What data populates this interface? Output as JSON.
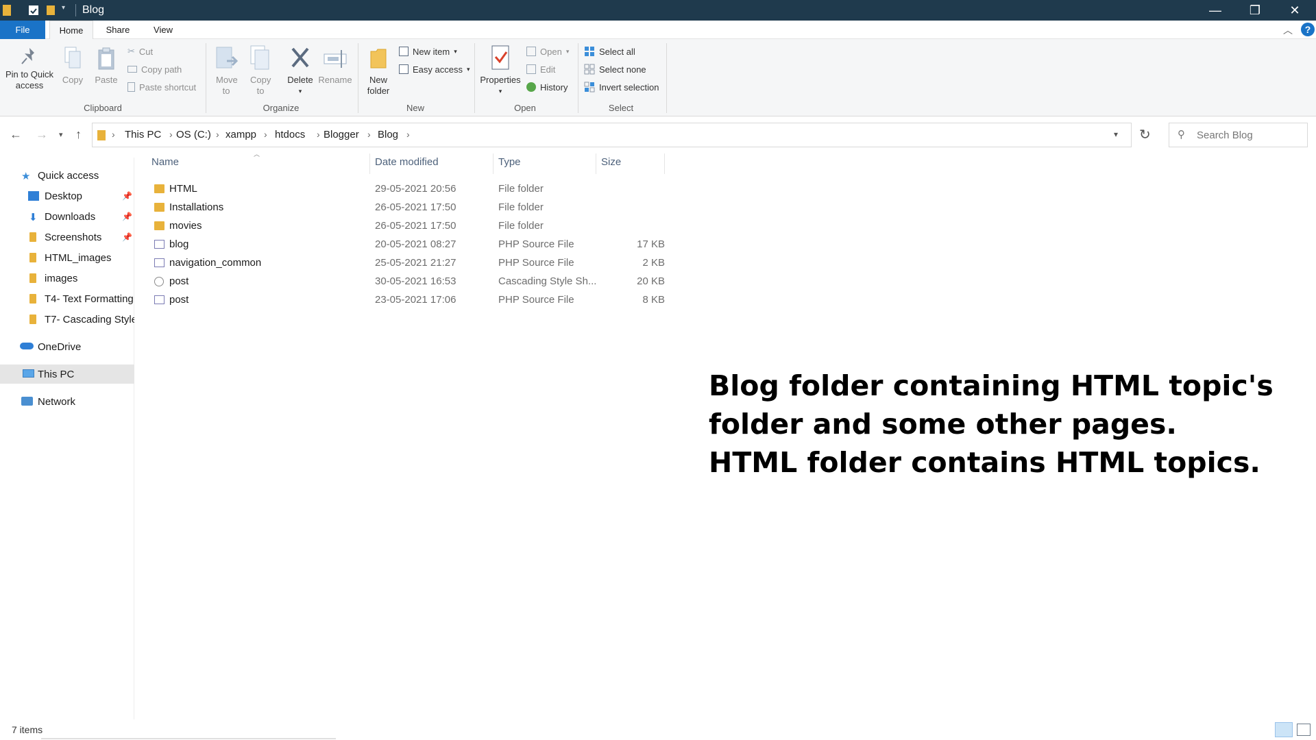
{
  "window": {
    "title": "Blog",
    "minimize_glyph": "—",
    "maximize_glyph": "❐",
    "close_glyph": "✕"
  },
  "ribbon_tabs": {
    "file": "File",
    "home": "Home",
    "share": "Share",
    "view": "View"
  },
  "ribbon": {
    "clipboard": {
      "pin_label": "Pin to Quick access",
      "copy_label": "Copy",
      "paste_label": "Paste",
      "cut_label": "Cut",
      "copy_path_label": "Copy path",
      "paste_shortcut_label": "Paste shortcut",
      "group_label": "Clipboard"
    },
    "organize": {
      "move_to_label": "Move to",
      "copy_to_label": "Copy to",
      "delete_label": "Delete",
      "rename_label": "Rename",
      "group_label": "Organize"
    },
    "new": {
      "new_folder_label": "New folder",
      "new_item_label": "New item",
      "easy_access_label": "Easy access",
      "group_label": "New"
    },
    "open": {
      "properties_label": "Properties",
      "open_label": "Open",
      "edit_label": "Edit",
      "history_label": "History",
      "group_label": "Open"
    },
    "select": {
      "select_all_label": "Select all",
      "select_none_label": "Select none",
      "invert_selection_label": "Invert selection",
      "group_label": "Select"
    }
  },
  "address": {
    "breadcrumbs": [
      "This PC",
      "OS (C:)",
      "xampp",
      "htdocs",
      "Blogger",
      "Blog"
    ],
    "search_placeholder": "Search Blog"
  },
  "nav_pane": {
    "quick_access": "Quick access",
    "items": [
      {
        "label": "Desktop",
        "pinned": true,
        "icon": "desktop-icon"
      },
      {
        "label": "Downloads",
        "pinned": true,
        "icon": "downloads-icon"
      },
      {
        "label": "Screenshots",
        "pinned": true,
        "icon": "folder-icon"
      },
      {
        "label": "HTML_images",
        "pinned": false,
        "icon": "folder-icon"
      },
      {
        "label": "images",
        "pinned": false,
        "icon": "folder-icon"
      },
      {
        "label": "T4- Text Formatting",
        "pinned": false,
        "icon": "folder-icon"
      },
      {
        "label": "T7- Cascading Style",
        "pinned": false,
        "icon": "folder-icon"
      }
    ],
    "onedrive": "OneDrive",
    "this_pc": "This PC",
    "network": "Network"
  },
  "file_list": {
    "columns": {
      "name": "Name",
      "date": "Date modified",
      "type": "Type",
      "size": "Size"
    },
    "rows": [
      {
        "name": "HTML",
        "date": "29-05-2021 20:56",
        "type": "File folder",
        "size": "",
        "icon": "folder-icon"
      },
      {
        "name": "Installations",
        "date": "26-05-2021 17:50",
        "type": "File folder",
        "size": "",
        "icon": "folder-icon"
      },
      {
        "name": "movies",
        "date": "26-05-2021 17:50",
        "type": "File folder",
        "size": "",
        "icon": "folder-icon"
      },
      {
        "name": "blog",
        "date": "20-05-2021 08:27",
        "type": "PHP Source File",
        "size": "17 KB",
        "icon": "php-file-icon"
      },
      {
        "name": "navigation_common",
        "date": "25-05-2021 21:27",
        "type": "PHP Source File",
        "size": "2 KB",
        "icon": "php-file-icon"
      },
      {
        "name": "post",
        "date": "30-05-2021 16:53",
        "type": "Cascading Style Sh...",
        "size": "20 KB",
        "icon": "css-file-icon"
      },
      {
        "name": "post",
        "date": "23-05-2021 17:06",
        "type": "PHP Source File",
        "size": "8 KB",
        "icon": "php-file-icon"
      }
    ]
  },
  "annotation": {
    "line1": "Blog folder containing HTML topic's",
    "line2": "folder and some other pages.",
    "line3": "HTML folder contains HTML topics."
  },
  "status_bar": {
    "item_count": "7 items"
  },
  "colors": {
    "titlebar": "#1f3a4d",
    "file_tab": "#1a73c7",
    "folder": "#e8b23b",
    "selected_nav": "#e5e5e5"
  }
}
